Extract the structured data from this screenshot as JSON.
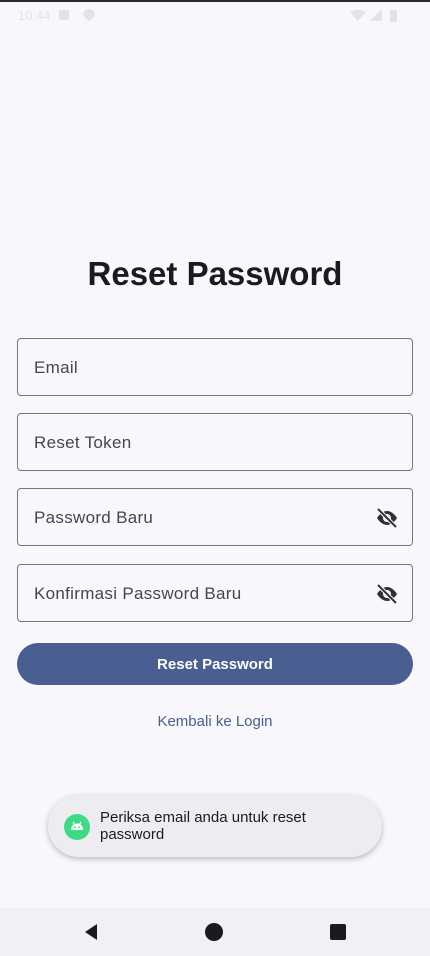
{
  "status_bar": {
    "time": "10:44",
    "left_icons": [
      "settings-icon",
      "location-icon"
    ],
    "right_icons": [
      "wifi-icon",
      "signal-icon",
      "battery-icon"
    ]
  },
  "page": {
    "title": "Reset Password"
  },
  "form": {
    "email_label": "Email",
    "token_label": "Reset Token",
    "new_password_label": "Password Baru",
    "confirm_password_label": "Konfirmasi Password Baru",
    "submit_label": "Reset Password",
    "back_link_label": "Kembali ke Login"
  },
  "toast": {
    "message": "Periksa email anda untuk reset password",
    "icon": "android-icon"
  },
  "nav_bar": {
    "buttons": [
      "back-icon",
      "home-icon",
      "recents-icon"
    ]
  },
  "colors": {
    "background": "#f8f7fc",
    "primary": "#4a5e92",
    "outline": "#76767e",
    "toast_background": "#ececf1"
  }
}
